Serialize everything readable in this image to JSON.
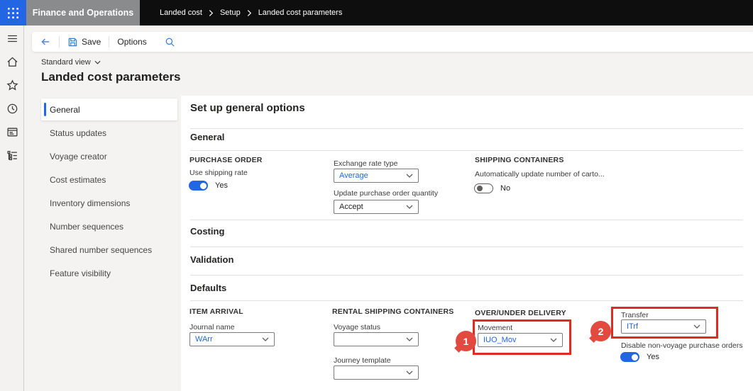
{
  "colors": {
    "accent": "#2266e3",
    "annotation_red": "#e02b20",
    "topbar_background": "#0e0e0e"
  },
  "topbar": {
    "app_name": "Finance and Operations",
    "breadcrumb": {
      "item1": "Landed cost",
      "item2": "Setup",
      "item3": "Landed cost parameters"
    }
  },
  "command_bar": {
    "save": "Save",
    "options": "Options"
  },
  "page_header": {
    "view_selector": "Standard view",
    "title": "Landed cost parameters"
  },
  "nav_tabs": {
    "items": [
      {
        "label": "General"
      },
      {
        "label": "Status updates"
      },
      {
        "label": "Voyage creator"
      },
      {
        "label": "Cost estimates"
      },
      {
        "label": "Inventory dimensions"
      },
      {
        "label": "Number sequences"
      },
      {
        "label": "Shared number sequences"
      },
      {
        "label": "Feature visibility"
      }
    ]
  },
  "content": {
    "heading": "Set up general options",
    "sections": {
      "general": "General",
      "costing": "Costing",
      "validation": "Validation",
      "defaults": "Defaults"
    },
    "general_fields": {
      "purchase_order_group": "PURCHASE ORDER",
      "use_shipping_rate_label": "Use shipping rate",
      "use_shipping_rate_value": "Yes",
      "exchange_rate_type_label": "Exchange rate type",
      "exchange_rate_type_value": "Average",
      "update_po_quantity_label": "Update purchase order quantity",
      "update_po_quantity_value": "Accept",
      "shipping_containers_group": "SHIPPING CONTAINERS",
      "auto_update_cartons_label": "Automatically update number of carto...",
      "auto_update_cartons_value": "No"
    },
    "defaults_fields": {
      "item_arrival_group": "ITEM ARRIVAL",
      "journal_name_label": "Journal name",
      "journal_name_value": "WArr",
      "rental_group": "RENTAL SHIPPING CONTAINERS",
      "voyage_status_label": "Voyage status",
      "voyage_status_value": "",
      "journey_template_label": "Journey template",
      "journey_template_value": "",
      "over_under_group": "OVER/UNDER DELIVERY",
      "movement_label": "Movement",
      "movement_value": "IUO_Mov",
      "transfer_label": "Transfer",
      "transfer_value": "ITrf",
      "disable_non_voyage_label": "Disable non-voyage purchase orders",
      "disable_non_voyage_value": "Yes"
    }
  },
  "annotations": {
    "step1": "1",
    "step2": "2"
  }
}
